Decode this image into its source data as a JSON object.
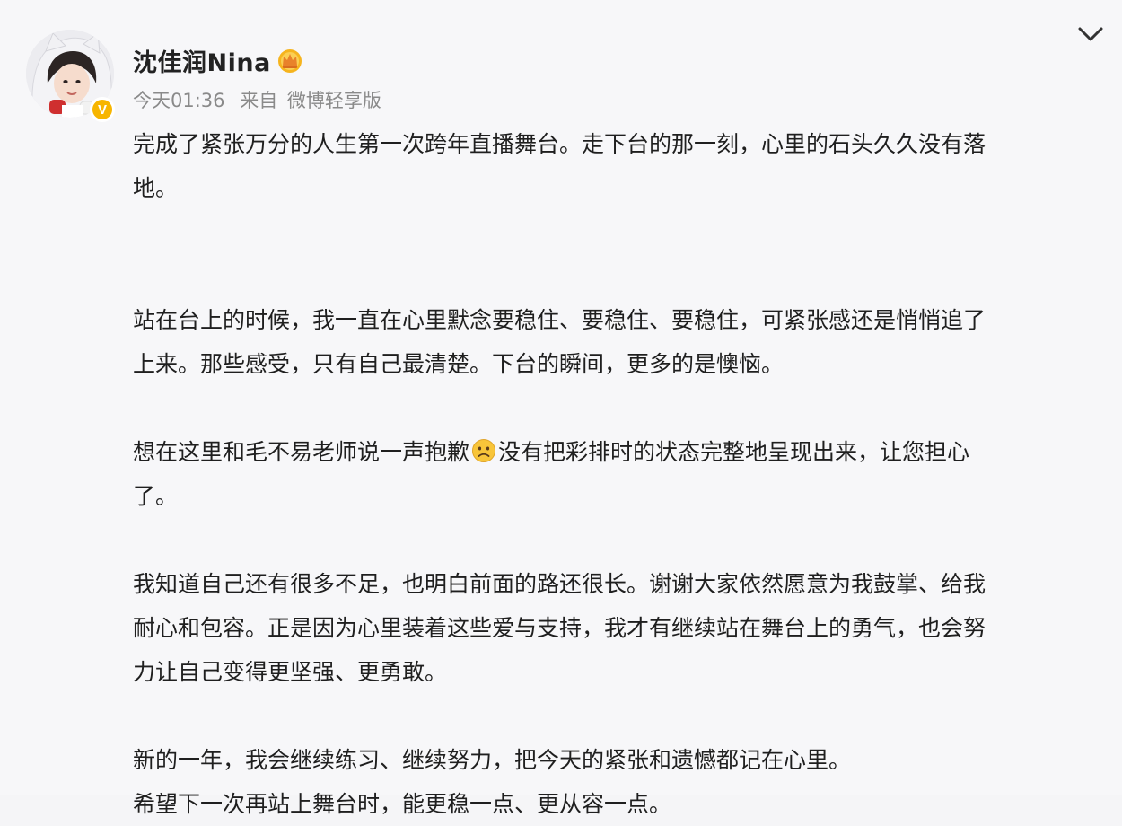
{
  "post": {
    "author_name": "沈佳润Nina",
    "time": "今天01:36",
    "source_prefix": "来自",
    "source": "微博轻享版",
    "emoji_sad": "sad-face-emoji",
    "paragraphs": {
      "p1a": "完成了紧张万分的人生第一次跨年直播舞台。走下台的那一刻，心里的石头久久没有落",
      "p1b": "地。",
      "p2a": "站在台上的时候，我一直在心里默念要稳住、要稳住、要稳住，可紧张感还是悄悄追了",
      "p2b": "上来。那些感受，只有自己最清楚。下台的瞬间，更多的是懊恼。",
      "p3a_before_emoji": "想在这里和毛不易老师说一声抱歉",
      "p3a_after_emoji": "没有把彩排时的状态完整地呈现出来，让您担心",
      "p3b": "了。",
      "p4a": "我知道自己还有很多不足，也明白前面的路还很长。谢谢大家依然愿意为我鼓掌、给我",
      "p4b": "耐心和包容。正是因为心里装着这些爱与支持，我才有继续站在舞台上的勇气，也会努",
      "p4c": "力让自己变得更坚强、更勇敢。",
      "p5a": "新的一年，我会继续练习、继续努力，把今天的紧张和遗憾都记在心里。",
      "p5b": "希望下一次再站上舞台时，能更稳一点、更从容一点。"
    }
  },
  "badge": {
    "verified_letter": "V",
    "verified_color": "#f7b500"
  },
  "icons": {
    "crown": "crown-icon",
    "chevron": "chevron-down-icon"
  }
}
